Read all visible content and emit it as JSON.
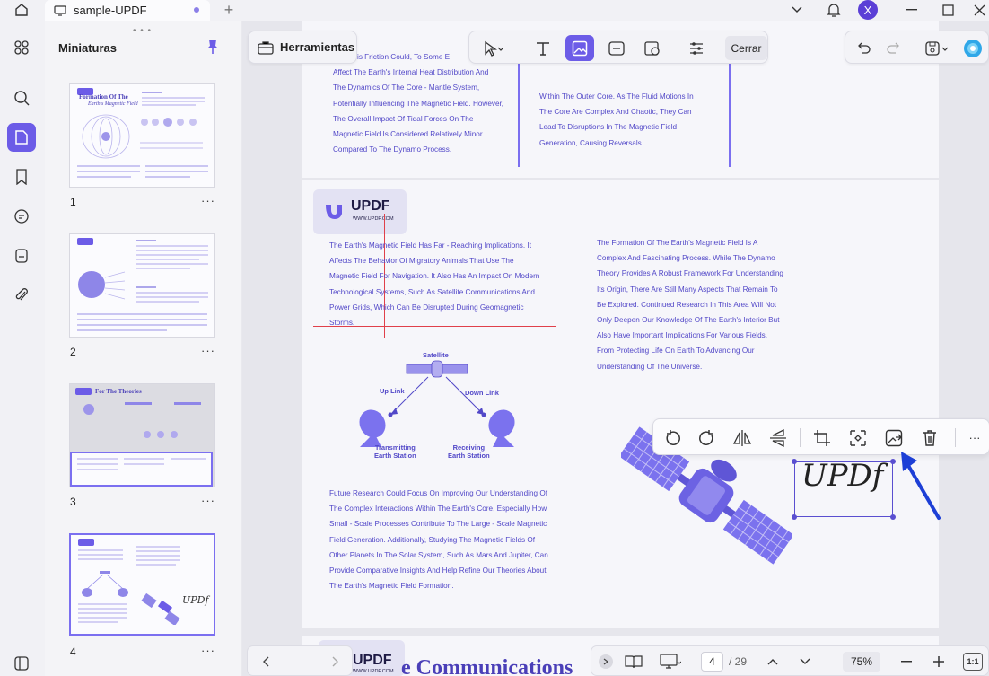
{
  "topbar": {
    "tab_title": "sample-UPDF",
    "avatar_initial": "X"
  },
  "thumbnails": {
    "panel_title": "Miniaturas",
    "pages": [
      {
        "number": "1",
        "heading": "Formation Of The",
        "subheading": "Earth's Magnetic Field"
      },
      {
        "number": "2"
      },
      {
        "number": "3",
        "heading": "For The Theories"
      },
      {
        "number": "4"
      }
    ],
    "more_label": "···"
  },
  "toolbar": {
    "tools_label": "Herramientas",
    "close_label": "Cerrar"
  },
  "page_top": {
    "col1_lines": [
      "tory, This Friction Could, To Some E",
      "Affect The Earth's Internal Heat Distribution And",
      "The Dynamics Of The Core - Mantle System,",
      "Potentially Influencing The Magnetic Field. However,",
      "The Overall Impact Of Tidal Forces On The",
      "Magnetic Field Is Considered Relatively Minor",
      "Compared To The Dynamo Process."
    ],
    "col2_lines": [
      "Within The Outer Core. As The Fluid Motions In",
      "The Core Are Complex And Chaotic, They Can",
      "Lead To Disruptions In The Magnetic Field",
      "Generation, Causing Reversals."
    ]
  },
  "page_main": {
    "logo_text": "UPDF",
    "logo_url": "WWW.UPDF.COM",
    "left_para": [
      "The Earth's Magnetic Field Has Far - Reaching Implications. It",
      "Affects The Behavior Of Migratory Animals That Use The",
      "Magnetic Field For Navigation. It Also Has An Impact On Modern",
      "Technological Systems, Such As Satellite Communications And",
      "Power Grids, Which Can Be Disrupted During Geomagnetic",
      "Storms."
    ],
    "right_para": [
      "The Formation Of The Earth's Magnetic Field Is A",
      "Complex And Fascinating Process. While The Dynamo",
      "Theory Provides A Robust Framework For Understanding",
      "Its Origin, There Are Still Many Aspects That Remain To",
      "Be Explored. Continued Research In This Area Will Not",
      "Only Deepen Our Knowledge Of The Earth's Interior But",
      "Also Have Important Implications For Various Fields,",
      "From Protecting Life On Earth To Advancing Our",
      "Understanding Of The Universe."
    ],
    "diagram": {
      "satellite": "Satellite",
      "up_link": "Up Link",
      "down_link": "Down Link",
      "tx_line1": "Transmitting",
      "tx_line2": "Earth Station",
      "rx_line1": "Receiving",
      "rx_line2": "Earth Station"
    },
    "future_para": [
      "Future Research Could Focus On Improving Our Understanding Of",
      "The Complex Interactions Within The Earth's Core, Especially How",
      "Small - Scale Processes Contribute To The Large - Scale Magnetic",
      "Field Generation. Additionally, Studying The Magnetic Fields Of",
      "Other Planets In The Solar System, Such As Mars And Jupiter, Can",
      "Provide Comparative Insights And Help Refine Our Theories About",
      "The Earth's Magnetic Field Formation."
    ],
    "signature": "UPDf"
  },
  "page_next": {
    "logo_text": "UPDF",
    "logo_url": "WWW.UPDF.COM",
    "heading": "e Communications"
  },
  "bottom_nav": {
    "current_page": "4",
    "total_pages": "/ 29",
    "zoom": "75%",
    "fit_label": "1:1"
  },
  "colors": {
    "accent": "#6c5ce7",
    "text_purple": "#5248c8",
    "satellite": "#7b72ee"
  }
}
